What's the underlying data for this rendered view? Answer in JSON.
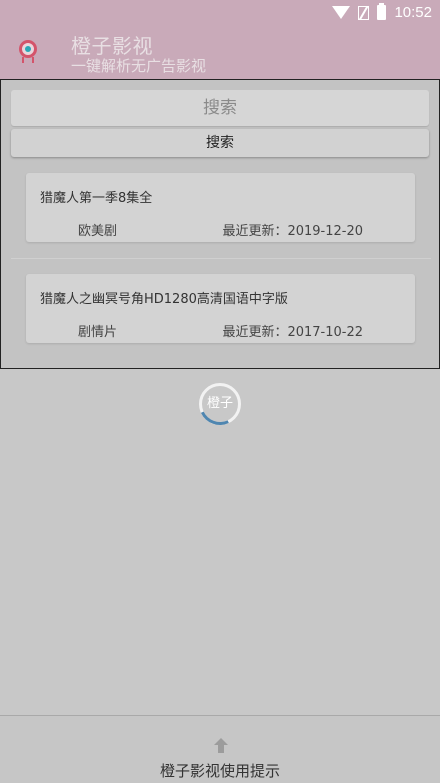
{
  "status_bar": {
    "time": "10:52",
    "icons": [
      "wifi-icon",
      "no-sim-icon",
      "battery-charging-icon"
    ]
  },
  "app_bar": {
    "title": "橙子影视",
    "subtitle": "一键解析无广告影视",
    "logo_icon": "app-logo-icon"
  },
  "search": {
    "placeholder": "搜索",
    "button_label": "搜索"
  },
  "results": [
    {
      "title": "猎魔人第一季8集全",
      "genre": "欧美剧",
      "updated": "最近更新：2019-12-20"
    },
    {
      "title": "猎魔人之幽冥号角HD1280高清国语中字版",
      "genre": "剧情片",
      "updated": "最近更新：2017-10-22"
    }
  ],
  "loader": {
    "label": "橙子"
  },
  "bottom_bar": {
    "hint": "橙子影视使用提示",
    "icon": "arrow-up-icon"
  },
  "colors": {
    "app_bar": "#c9aab9",
    "background": "#c8c8c8",
    "loader_accent": "#4f86b0"
  }
}
